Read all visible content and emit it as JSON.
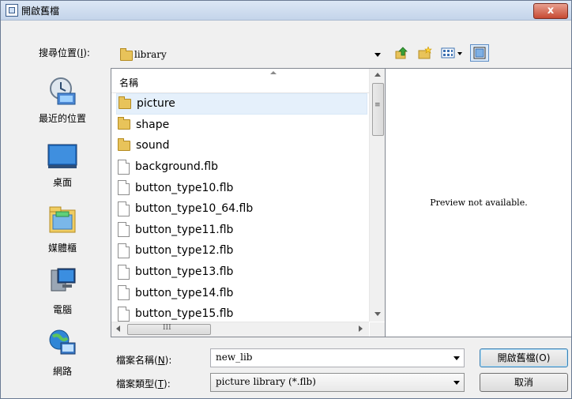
{
  "title_bar": {
    "title": "開啟舊檔",
    "close_label": "x"
  },
  "look_in": {
    "label": "搜尋位置(",
    "label_accel": "I",
    "label_suffix": "):",
    "value": "library"
  },
  "places": [
    {
      "label": "最近的位置",
      "icon": "recent-places-icon"
    },
    {
      "label": "桌面",
      "icon": "desktop-icon"
    },
    {
      "label": "媒體櫃",
      "icon": "libraries-icon"
    },
    {
      "label": "電腦",
      "icon": "computer-icon"
    },
    {
      "label": "網路",
      "icon": "network-icon"
    }
  ],
  "file_list": {
    "column_header": "名稱",
    "items": [
      {
        "name": "picture",
        "type": "folder",
        "selected": true
      },
      {
        "name": "shape",
        "type": "folder"
      },
      {
        "name": "sound",
        "type": "folder"
      },
      {
        "name": "background.flb",
        "type": "file"
      },
      {
        "name": "button_type10.flb",
        "type": "file"
      },
      {
        "name": "button_type10_64.flb",
        "type": "file"
      },
      {
        "name": "button_type11.flb",
        "type": "file"
      },
      {
        "name": "button_type12.flb",
        "type": "file"
      },
      {
        "name": "button_type13.flb",
        "type": "file"
      },
      {
        "name": "button_type14.flb",
        "type": "file"
      },
      {
        "name": "button_type15.flb",
        "type": "file"
      }
    ],
    "hscroll_grip": "III",
    "vscroll_grip": "≡"
  },
  "preview": {
    "text": "Preview not available."
  },
  "filename": {
    "label": "檔案名稱(",
    "label_accel": "N",
    "label_suffix": "):",
    "value": "new_lib"
  },
  "filetype": {
    "label": "檔案類型(",
    "label_accel": "T",
    "label_suffix": "):",
    "value": "picture library (*.flb)"
  },
  "buttons": {
    "open": "開啟舊檔(O)",
    "cancel": "取消"
  },
  "colors": {
    "title_bar": "#c4d4ea",
    "close_button": "#c74a33",
    "selection": "#e5f0fb",
    "folder": "#e8c35a"
  }
}
